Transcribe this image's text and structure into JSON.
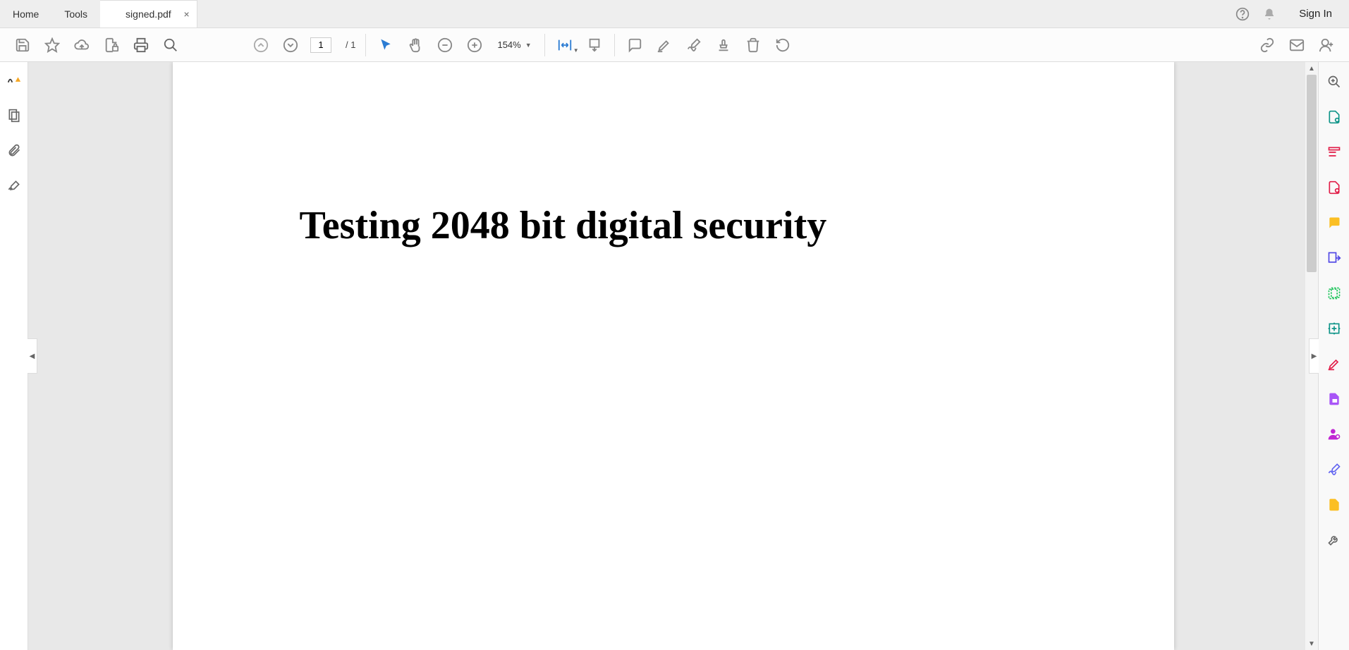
{
  "tabs": {
    "home": "Home",
    "tools": "Tools",
    "file": "signed.pdf"
  },
  "header": {
    "sign_in": "Sign In"
  },
  "toolbar": {
    "current_page": "1",
    "total_pages": "/  1",
    "zoom": "154%"
  },
  "document": {
    "heading": "Testing 2048 bit digital security"
  }
}
